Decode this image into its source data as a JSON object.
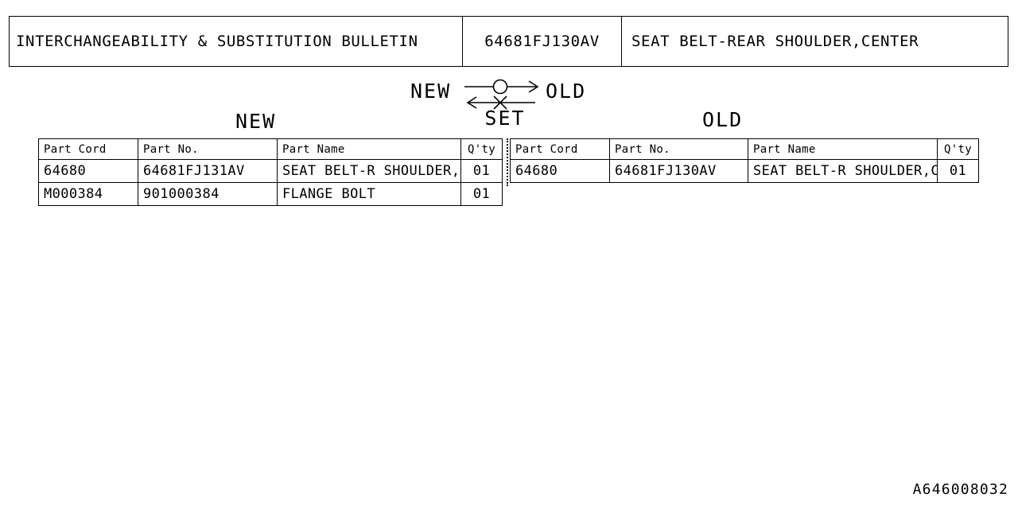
{
  "header": {
    "title": "INTERCHANGEABILITY & SUBSTITUTION BULLETIN",
    "part_number": "64681FJ130AV",
    "part_name": "SEAT BELT-REAR SHOULDER,CENTER"
  },
  "exchange_diagram": {
    "left_label": "NEW",
    "right_label": "OLD",
    "bottom_label": "SET",
    "forward_marker": "circle-ok",
    "reverse_marker": "cross-not-allowed",
    "forward_direction": "new-to-old",
    "reverse_direction": "old-to-new"
  },
  "new_section": {
    "caption": "NEW",
    "columns": [
      "Part Cord",
      "Part No.",
      "Part Name",
      "Q'ty"
    ],
    "rows": [
      {
        "part_cord": "64680",
        "part_no": "64681FJ131AV",
        "part_name": "SEAT BELT-R SHOULDER,CTR",
        "qty": "01"
      },
      {
        "part_cord": "M000384",
        "part_no": "901000384",
        "part_name": "FLANGE BOLT",
        "qty": "01"
      }
    ]
  },
  "old_section": {
    "caption": "OLD",
    "columns": [
      "Part Cord",
      "Part No.",
      "Part Name",
      "Q'ty"
    ],
    "rows": [
      {
        "part_cord": "64680",
        "part_no": "64681FJ130AV",
        "part_name": "SEAT BELT-R SHOULDER,CTR",
        "qty": "01"
      }
    ]
  },
  "footer": {
    "doc_ref": "A646008032"
  }
}
